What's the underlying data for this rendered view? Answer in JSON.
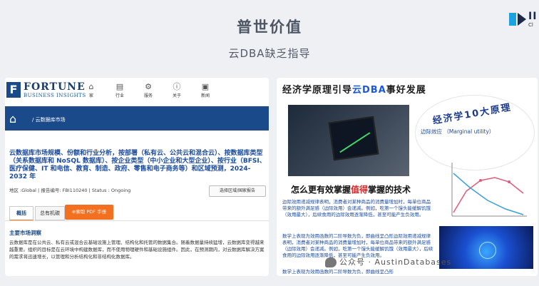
{
  "slide": {
    "title": "普世价值",
    "subtitle": "云DBA缺乏指导",
    "logo_text": "II",
    "logo_sub": "Cl"
  },
  "left": {
    "brand_name": "FORTUNE",
    "brand_tag": "BUSINESS INSIGHTS",
    "nav": [
      "家",
      "行业",
      "服务",
      "关于",
      "新闻"
    ],
    "breadcrumb": "/ 云数据库市场",
    "report_title": "云数据库市场规模、份额和行业分析，按部署（私有云、公共云和混合云）、按数据库类型（关系数据库和 NoSQL 数据库）、按企业类型（中小企业和大型企业）、按行业（BFSI、医疗保健、IT 和电信、教育、制造、政府、零售和电子商务等）和区域预测，2024-2032 年",
    "meta": "地区 :Global | 报告编号: FBI110240 | Status : Ongoing",
    "select_label": "选择区域/国家报告",
    "tabs": [
      "概括",
      "总有机碳"
    ],
    "pdf_button": "⊕索取 PDF 手册",
    "section_heading": "主要市场洞察",
    "section_body": "云数据库是在公共云、私有云或混合云基础设施上管理、结构化和托管的数据集合。随着数据量持续猛增，云数据库变得越来越重要。组织的目标是在云环境中构建数据库，而不使用物理硬件和基础设施组件。因此，在预测期内，对云数据库解决方案的需求将迅速增长，以管理和分析结构化和非结构化数据库。"
  },
  "right": {
    "title_pre": "经济学原理引导",
    "title_hl": "云DBA",
    "title_post": "事好发展",
    "bubble_title": "经济学10大原理",
    "bubble_sub": "边际效应 （Marginal utility）",
    "big_line_pre": "怎么更有效掌握",
    "big_line_hl": "值得",
    "big_line_post": "掌握的技术",
    "para1": "边际效用递减规律表明，消费者对某种商品的消费量增加时，每单位商品带来的额外满足感（边际效用）会递减。例如，吃第一个馒头能缓解饥饿（效用最大），后续食用的边际效用逐渐降低，甚至可能产生负效用。",
    "para2": "数学上表现为效用函数的二阶导数为负，即曲线呈凸形边际效用递减规律表明，消费者对某种商品的消费量增加时，每单位商品带来的额外满足感（边际效用）会递减。例如，吃第一个馒头能缓解饥饿（效用最大），后续食用的边际效用逐渐降低，甚至可能产生负效用。",
    "para3": "数学上表现为效用函数的二阶导数为负，即曲线呈凸形",
    "watermark": "公众号 · AustinDatabases"
  }
}
